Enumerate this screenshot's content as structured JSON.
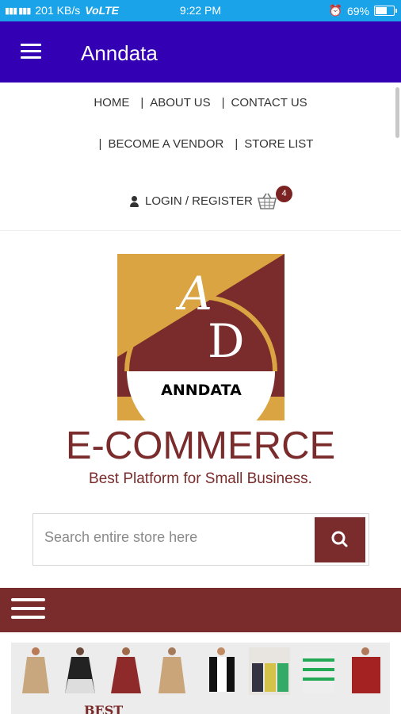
{
  "status_bar": {
    "network_speed": "201 KB/s",
    "network_type": "VoLTE",
    "time": "9:22 PM",
    "battery": "69%",
    "battery_level": 0.69
  },
  "app_bar": {
    "title": "Anndata",
    "menu_icon": "hamburger-menu-icon"
  },
  "top_nav": {
    "row1": [
      "HOME",
      "ABOUT US",
      "CONTACT US"
    ],
    "row2": [
      "BECOME A VENDOR",
      "STORE LIST"
    ],
    "separator": "|"
  },
  "account": {
    "login_label": "LOGIN / REGISTER",
    "cart_count": "4",
    "user_icon": "user-icon",
    "cart_icon": "basket-icon"
  },
  "logo": {
    "letter_a": "A",
    "letter_d": "D",
    "wordmark": "ANNDATA"
  },
  "brand": {
    "headline": "E-COMMERCE",
    "tagline": "Best Platform for Small Business."
  },
  "search": {
    "placeholder": "Search entire store here",
    "value": "",
    "button_icon": "search-icon"
  },
  "category_bar": {
    "menu_icon": "hamburger-menu-icon"
  },
  "banner": {
    "text": "BEST"
  },
  "colors": {
    "status_bar": "#1aa3e8",
    "app_bar": "#3300b3",
    "brand": "#7a2b2b",
    "gold": "#d9a441"
  }
}
